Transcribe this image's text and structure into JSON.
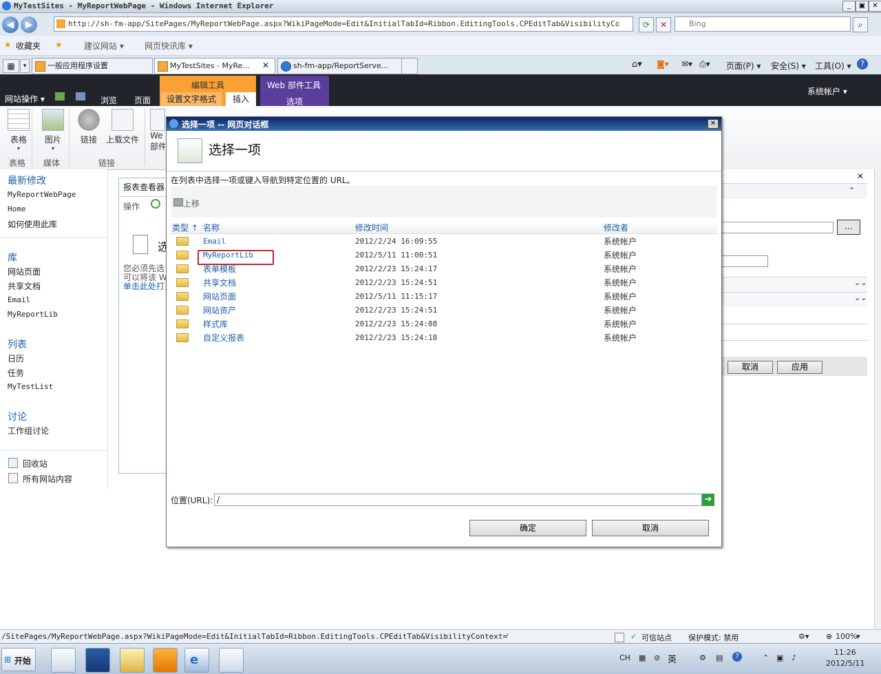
{
  "window": {
    "title": "MyTestSites - MyReportWebPage - Windows Internet Explorer",
    "minimize": "_",
    "restore": "▣",
    "close": "✕"
  },
  "address_bar": {
    "url": "http://sh-fm-app/SitePages/MyReportWebPage.aspx?WikiPageMode=Edit&InitialTabId=Ribbon.EditingTools.CPEditTab&VisibilityContext=WSSWiki",
    "search_placeholder": "Bing"
  },
  "favorites_bar": {
    "favorites": "收藏夹",
    "suggested_sites": "建议网站 ▾",
    "web_slice_gallery": "网页快讯库 ▾"
  },
  "browser_tabs": [
    {
      "label": "一般应用程序设置"
    },
    {
      "label": "MyTestSites - MyRe..."
    },
    {
      "label": "sh-fm-app/ReportServe..."
    }
  ],
  "command_bar": {
    "page": "页面(P) ▾",
    "safety": "安全(S) ▾",
    "tools": "工具(O) ▾"
  },
  "ribbon_top": {
    "site_actions": "网站操作 ▾",
    "browse": "浏览",
    "page": "页面",
    "editing_tools": "编辑工具",
    "format_text": "设置文字格式",
    "insert": "插入",
    "web_part_tools": "Web 部件工具",
    "options": "选项",
    "user": "系统帐户 ▾"
  },
  "ribbon": {
    "table": "表格",
    "picture": "图片",
    "link": "链接",
    "upload": "上载文件",
    "web_part": "We\n部件",
    "group_table": "表格",
    "group_media": "媒体",
    "group_links": "链接"
  },
  "left_nav": {
    "recent_header": "最新修改",
    "recent": [
      "MyReportWebPage",
      "Home",
      "如何使用此库"
    ],
    "libraries_header": "库",
    "libraries": [
      "网站页面",
      "共享文档",
      "Email",
      "MyReportLib"
    ],
    "lists_header": "列表",
    "lists": [
      "日历",
      "任务",
      "MyTestList"
    ],
    "discussions_header": "讨论",
    "discussions": [
      "工作组讨论"
    ],
    "recycle_bin": "回收站",
    "all_content": "所有网站内容"
  },
  "webpart": {
    "title": "报表查看器",
    "actions": "操作",
    "select": "选",
    "text1": "您必须先选",
    "text2": "可以将该 W",
    "link": "单击此处打开"
  },
  "tool_pane": {
    "cancel": "取消",
    "apply": "应用",
    "browse": "..."
  },
  "dialog": {
    "title": "选择一项 -- 网页对话框",
    "heading": "选择一项",
    "description": "在列表中选择一项或键入导航到特定位置的 URL。",
    "up": "上移",
    "columns": {
      "type": "类型 ↑",
      "name": "名称",
      "modified": "修改时间",
      "modified_by": "修改者"
    },
    "rows": [
      {
        "name": "Email",
        "modified": "2012/2/24 16:09:55",
        "by": "系统帐户"
      },
      {
        "name": "MyReportLib",
        "modified": "2012/5/11 11:00:51",
        "by": "系统帐户"
      },
      {
        "name": "表单模板",
        "modified": "2012/2/23 15:24:17",
        "by": "系统帐户"
      },
      {
        "name": "共享文档",
        "modified": "2012/2/23 15:24:51",
        "by": "系统帐户"
      },
      {
        "name": "网站页面",
        "modified": "2012/5/11 11:15:17",
        "by": "系统帐户"
      },
      {
        "name": "网站资产",
        "modified": "2012/2/23 15:24:51",
        "by": "系统帐户"
      },
      {
        "name": "样式库",
        "modified": "2012/2/23 15:24:08",
        "by": "系统帐户"
      },
      {
        "name": "自定义报表",
        "modified": "2012/2/23 15:24:18",
        "by": "系统帐户"
      }
    ],
    "url_label": "位置(URL):",
    "url_value": "/",
    "ok": "确定",
    "cancel": "取消",
    "highlight_color": "#c0262c"
  },
  "status_bar": {
    "url": "/SitePages/MyReportWebPage.aspx?WikiPageMode=Edit&InitialTabId=Ribbon.EditingTools.CPEditTab&VisibilityContext=WSSWikiPage",
    "trusted": "可信站点",
    "protected_mode": "保护模式: 禁用",
    "zoom": "100%"
  },
  "taskbar": {
    "start": "开始",
    "lang": "CH",
    "ime": "英",
    "time": "11:26",
    "date": "2012/5/11"
  }
}
